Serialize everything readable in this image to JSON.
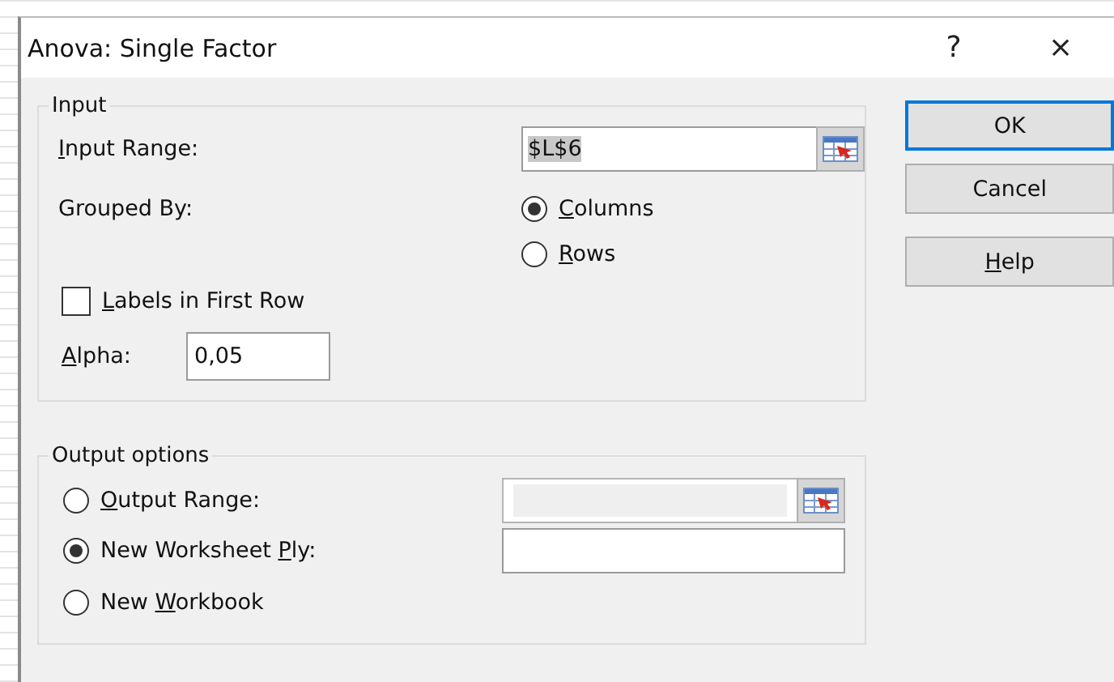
{
  "window": {
    "title": "Anova: Single Factor",
    "help": "?",
    "close": "×"
  },
  "input": {
    "legend": "Input",
    "range_label": {
      "key": "I",
      "post": "nput Range:"
    },
    "range_value": "$L$6",
    "grouped_label": "Grouped By:",
    "grouped_options": [
      {
        "label": {
          "key": "C",
          "post": "olumns"
        },
        "selected": true
      },
      {
        "label": {
          "key": "R",
          "post": "ows"
        },
        "selected": false
      }
    ],
    "labels_checkbox": {
      "label": {
        "key": "L",
        "post": "abels in First Row"
      },
      "checked": false
    },
    "alpha_label": {
      "key": "A",
      "post": "lpha:"
    },
    "alpha_value": "0,05"
  },
  "output": {
    "legend": "Output options",
    "options": [
      {
        "kind": "range",
        "label": {
          "key": "O",
          "post": "utput Range:"
        },
        "selected": false
      },
      {
        "kind": "text",
        "label": {
          "pre": "New Worksheet ",
          "key": "P",
          "post": "ly:"
        },
        "selected": true
      },
      {
        "kind": "none",
        "label": {
          "pre": "New ",
          "key": "W",
          "post": "orkbook"
        },
        "selected": false
      }
    ]
  },
  "buttons": [
    {
      "label": {
        "post": "OK"
      },
      "default": true
    },
    {
      "label": {
        "post": "Cancel"
      },
      "default": false
    },
    {
      "label": {
        "key": "H",
        "post": "elp"
      },
      "default": false
    }
  ]
}
